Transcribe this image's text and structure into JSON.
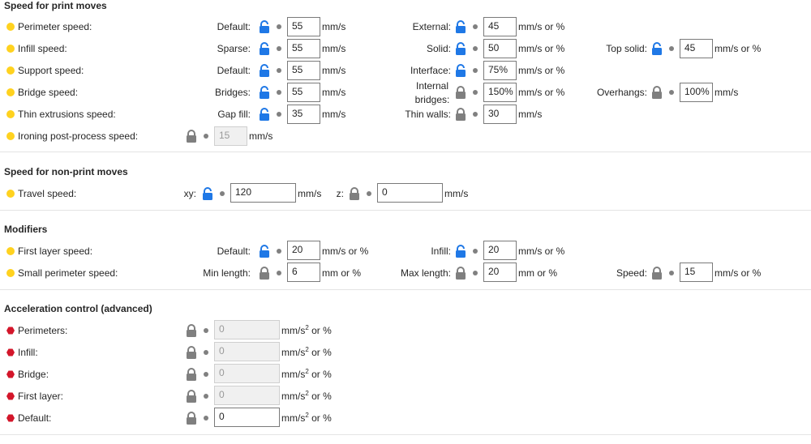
{
  "colors": {
    "mode_simple": "#ffd21f",
    "mode_expert": "#d3162a",
    "lock_unlocked": "#1f78e6",
    "lock_locked": "#7f7f7f"
  },
  "sections": {
    "print": "Speed for print moves",
    "nonprint": "Speed for non-print moves",
    "modifiers": "Modifiers",
    "accel": "Acceleration control (advanced)"
  },
  "perimeter": {
    "label": "Perimeter speed:",
    "default_label": "Default:",
    "default_value": "55",
    "default_unit": "mm/s",
    "external_label": "External:",
    "external_value": "45",
    "external_unit": "mm/s or %"
  },
  "infill": {
    "label": "Infill speed:",
    "sparse_label": "Sparse:",
    "sparse_value": "55",
    "sparse_unit": "mm/s",
    "solid_label": "Solid:",
    "solid_value": "50",
    "solid_unit": "mm/s or %",
    "top_label": "Top solid:",
    "top_value": "45",
    "top_unit": "mm/s or %"
  },
  "support": {
    "label": "Support speed:",
    "default_label": "Default:",
    "default_value": "55",
    "default_unit": "mm/s",
    "interface_label": "Interface:",
    "interface_value": "75%",
    "interface_unit": "mm/s or %"
  },
  "bridge": {
    "label": "Bridge speed:",
    "bridges_label": "Bridges:",
    "bridges_value": "55",
    "bridges_unit": "mm/s",
    "internal_label_1": "Internal",
    "internal_label_2": "bridges:",
    "internal_value": "150%",
    "internal_unit": "mm/s or %",
    "overhangs_label": "Overhangs:",
    "overhangs_value": "100%",
    "overhangs_unit": "mm/s"
  },
  "thin": {
    "label": "Thin extrusions speed:",
    "gap_label": "Gap fill:",
    "gap_value": "35",
    "gap_unit": "mm/s",
    "walls_label": "Thin walls:",
    "walls_value": "30",
    "walls_unit": "mm/s"
  },
  "ironing": {
    "label": "Ironing post-process speed:",
    "value": "15",
    "unit": "mm/s"
  },
  "travel": {
    "label": "Travel speed:",
    "xy_label": "xy:",
    "xy_value": "120",
    "xy_unit": "mm/s",
    "z_label": "z:",
    "z_value": "0",
    "z_unit": "mm/s"
  },
  "first_layer": {
    "label": "First layer speed:",
    "default_label": "Default:",
    "default_value": "20",
    "default_unit": "mm/s or %",
    "infill_label": "Infill:",
    "infill_value": "20",
    "infill_unit": "mm/s or %"
  },
  "small_perimeter": {
    "label": "Small perimeter speed:",
    "min_label": "Min length:",
    "min_value": "6",
    "min_unit": "mm or %",
    "max_label": "Max length:",
    "max_value": "20",
    "max_unit": "mm or %",
    "speed_label": "Speed:",
    "speed_value": "15",
    "speed_unit": "mm/s or %"
  },
  "accel": {
    "unit_base": "mm/s",
    "unit_sup": "2",
    "unit_tail": " or %",
    "rows": [
      {
        "label": "Perimeters:",
        "value": "0"
      },
      {
        "label": "Infill:",
        "value": "0"
      },
      {
        "label": "Bridge:",
        "value": "0"
      },
      {
        "label": "First layer:",
        "value": "0"
      },
      {
        "label": "Default:",
        "value": "0"
      }
    ]
  }
}
